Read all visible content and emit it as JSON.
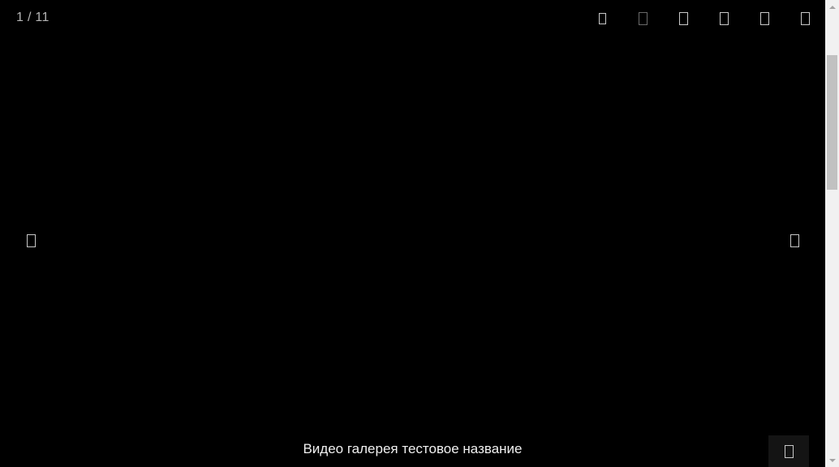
{
  "viewer": {
    "counter": "1 / 11",
    "caption": "Видео галерея тестовое название",
    "toolbar_icons": [
      "zoom-icon",
      "fullscreen-icon",
      "share-icon",
      "download-icon",
      "thumbnails-icon",
      "close-icon"
    ],
    "nav_icons": {
      "prev": "chevron-left-icon",
      "next": "chevron-right-icon"
    },
    "corner_icon": "thumbnails-toggle-icon"
  },
  "colors": {
    "background": "#000000",
    "text": "#f0f0f0",
    "counter_text": "#b5b5b5",
    "icon": "#c8c8c8"
  }
}
